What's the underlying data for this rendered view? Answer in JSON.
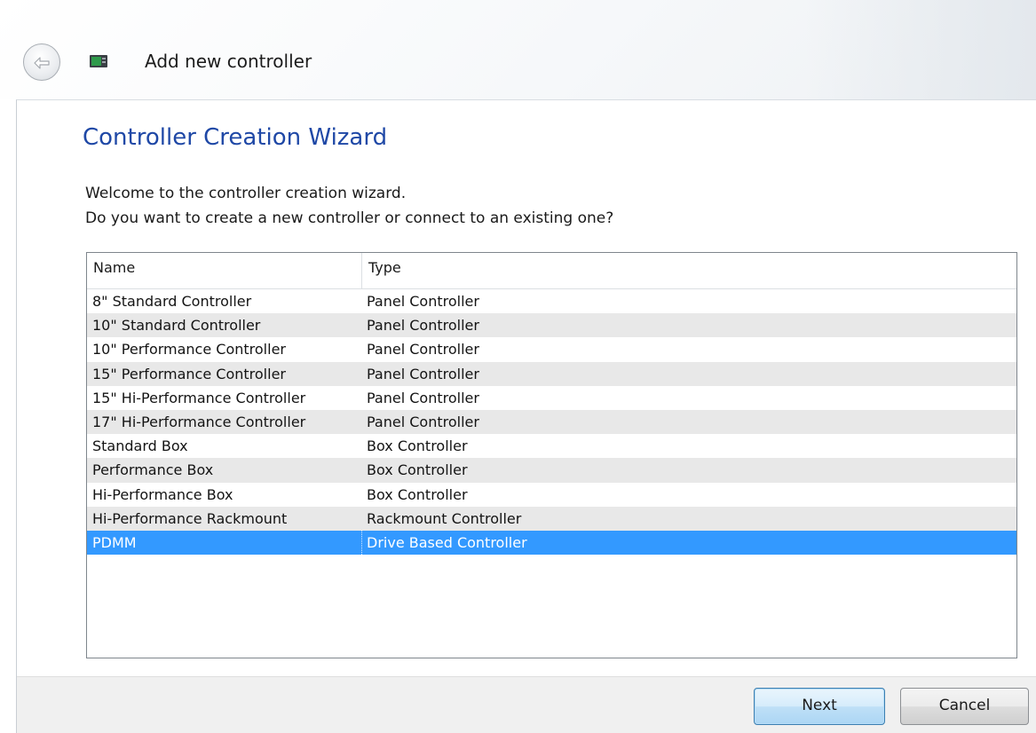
{
  "window": {
    "title": "Add new controller",
    "icons": {
      "back": "back-arrow-icon",
      "app": "controller-icon"
    }
  },
  "wizard": {
    "title": "Controller Creation Wizard",
    "instruction_1": "Welcome to the controller creation wizard.",
    "instruction_2": "Do you want to create a new controller or connect to an existing one?"
  },
  "list": {
    "columns": [
      "Name",
      "Type"
    ],
    "rows": [
      {
        "name": "8\" Standard Controller",
        "type": "Panel Controller"
      },
      {
        "name": "10\" Standard Controller",
        "type": "Panel Controller"
      },
      {
        "name": "10\" Performance Controller",
        "type": "Panel Controller"
      },
      {
        "name": "15\" Performance Controller",
        "type": "Panel Controller"
      },
      {
        "name": "15\" Hi-Performance Controller",
        "type": "Panel Controller"
      },
      {
        "name": "17\" Hi-Performance Controller",
        "type": "Panel Controller"
      },
      {
        "name": "Standard Box",
        "type": "Box Controller"
      },
      {
        "name": "Performance Box",
        "type": "Box Controller"
      },
      {
        "name": "Hi-Performance Box",
        "type": "Box Controller"
      },
      {
        "name": "Hi-Performance Rackmount",
        "type": "Rackmount Controller"
      },
      {
        "name": "PDMM",
        "type": "Drive Based Controller"
      }
    ],
    "selected_index": 10
  },
  "buttons": {
    "next": "Next",
    "cancel": "Cancel"
  },
  "colors": {
    "heading": "#1f48a6",
    "selection": "#3399ff",
    "alt_row": "#e8e8e8",
    "footer": "#f0f0f0"
  }
}
